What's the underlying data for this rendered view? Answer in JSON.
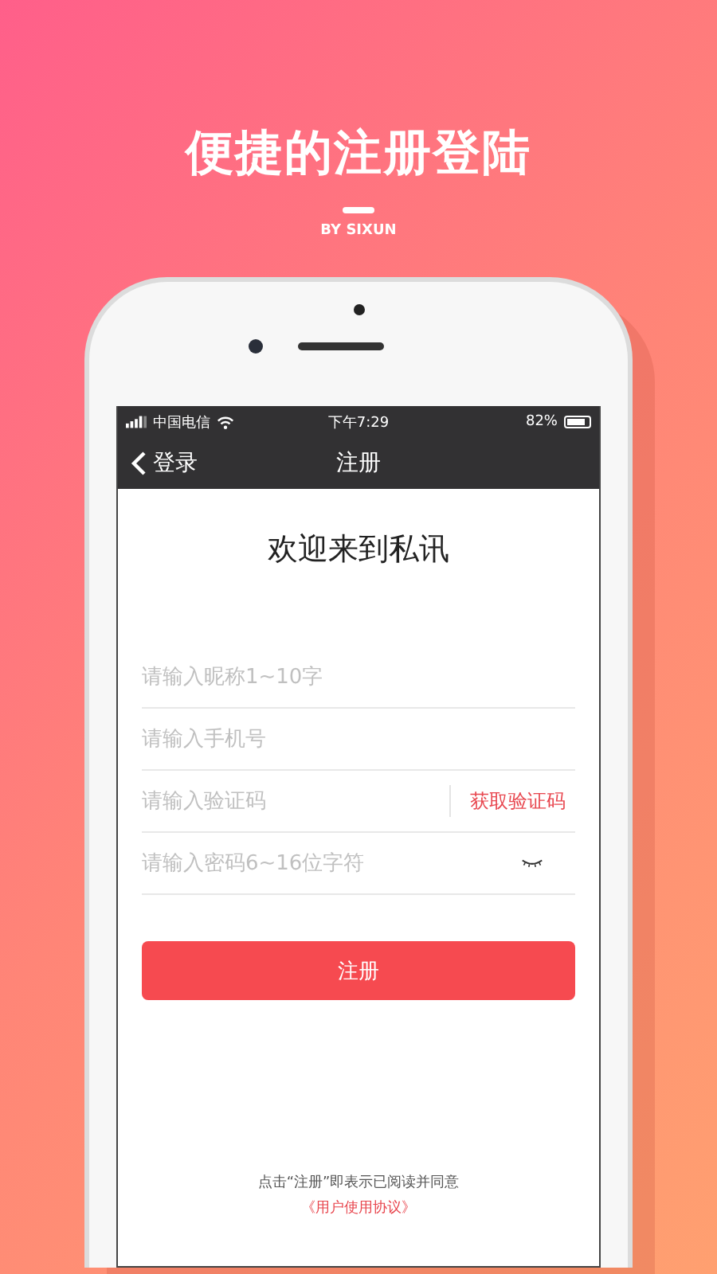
{
  "headline": "便捷的注册登陆",
  "byline": "BY SIXUN",
  "status_bar": {
    "carrier": "中国电信",
    "time": "下午7:29",
    "battery": "82%"
  },
  "nav_bar": {
    "back": "登录",
    "title": "注册"
  },
  "welcome": "欢迎来到私讯",
  "fields": [
    {
      "kind": "text",
      "placeholder": "请输入昵称1~10字"
    },
    {
      "kind": "text",
      "placeholder": "请输入手机号"
    },
    {
      "kind": "code",
      "placeholder": "请输入验证码",
      "action": "获取验证码"
    },
    {
      "kind": "password",
      "placeholder": "请输入密码6~16位字符"
    }
  ],
  "submit": "注册",
  "terms": {
    "text": "点击“注册”即表示已阅读并同意",
    "link": "《用户使用协议》"
  }
}
